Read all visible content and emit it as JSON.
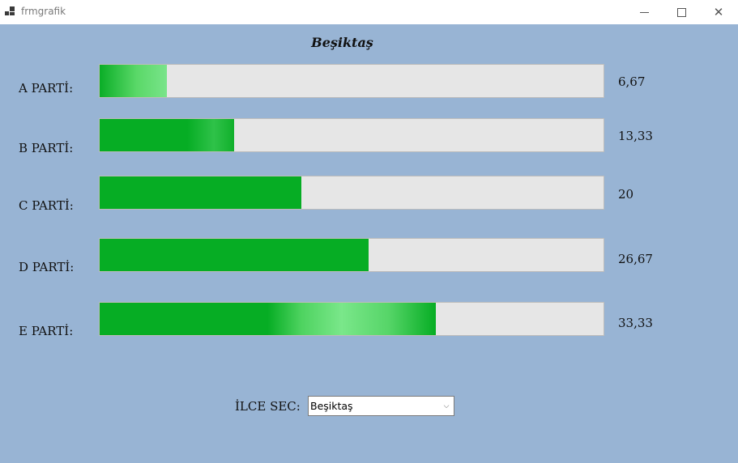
{
  "window": {
    "title": "frmgrafik",
    "close_glyph": "✕"
  },
  "header": {
    "title": "Beşiktaş"
  },
  "parties": [
    {
      "label": "A PARTİ:",
      "value": "6,67",
      "percent": 6.67
    },
    {
      "label": "B PARTİ:",
      "value": "13,33",
      "percent": 13.33
    },
    {
      "label": "C PARTİ:",
      "value": "20",
      "percent": 20
    },
    {
      "label": "D PARTİ:",
      "value": "26,67",
      "percent": 26.67
    },
    {
      "label": "E PARTİ:",
      "value": "33,33",
      "percent": 33.33
    }
  ],
  "district": {
    "label": "İLCE SEC:",
    "selected": "Beşiktaş",
    "arrow_glyph": "⌵"
  },
  "colors": {
    "background": "#98b4d4",
    "bar_track": "#e6e6e6",
    "bar_fill": "#06ad24"
  },
  "bar_max": 50
}
